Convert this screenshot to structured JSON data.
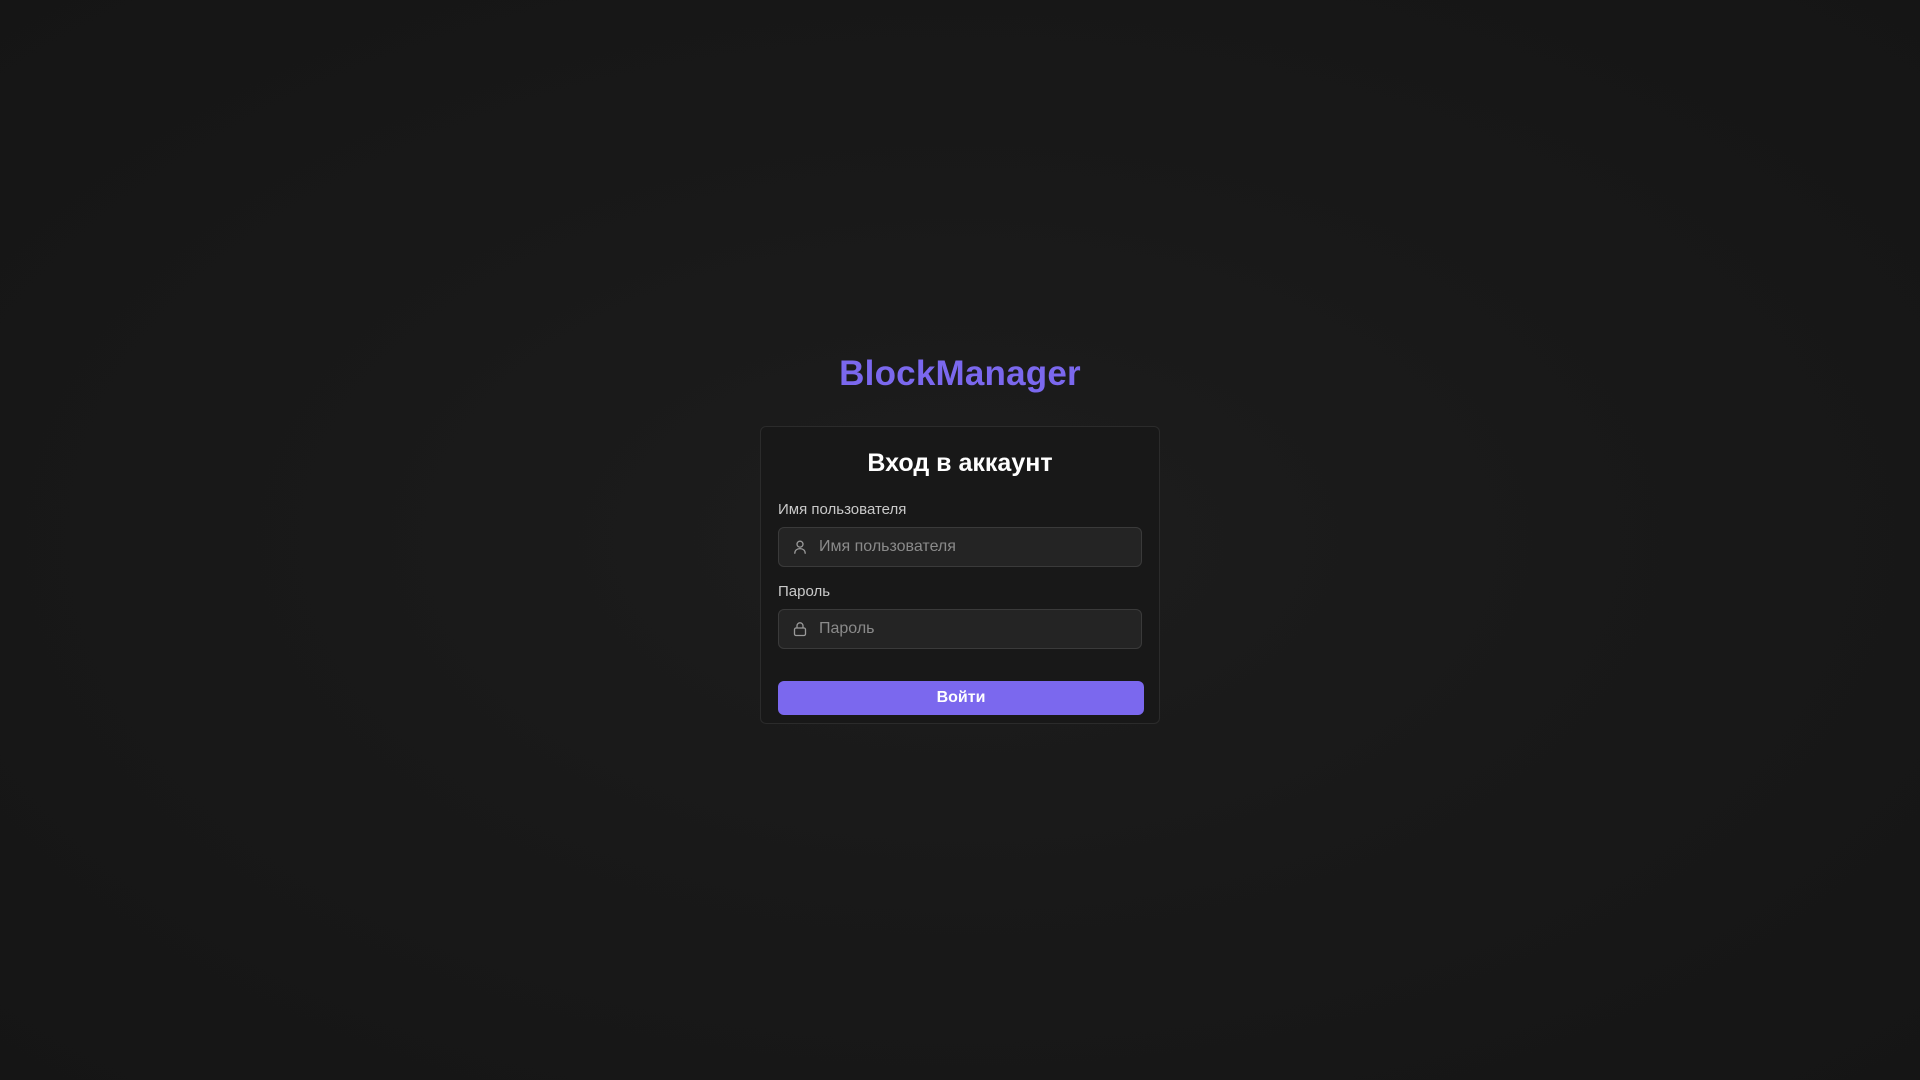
{
  "app": {
    "brand": "BlockManager"
  },
  "login": {
    "title": "Вход в аккаунт",
    "username": {
      "label": "Имя пользователя",
      "placeholder": "Имя пользователя",
      "value": "",
      "icon": "user-icon"
    },
    "password": {
      "label": "Пароль",
      "placeholder": "Пароль",
      "value": "",
      "icon": "lock-icon"
    },
    "submit_label": "Войти"
  },
  "colors": {
    "accent": "#7b68ee",
    "background": "#171717",
    "card": "#181818",
    "input_background": "#242424",
    "input_border": "#3a3a3a",
    "label": "#c9c9c9",
    "placeholder": "#8a8a8a"
  }
}
